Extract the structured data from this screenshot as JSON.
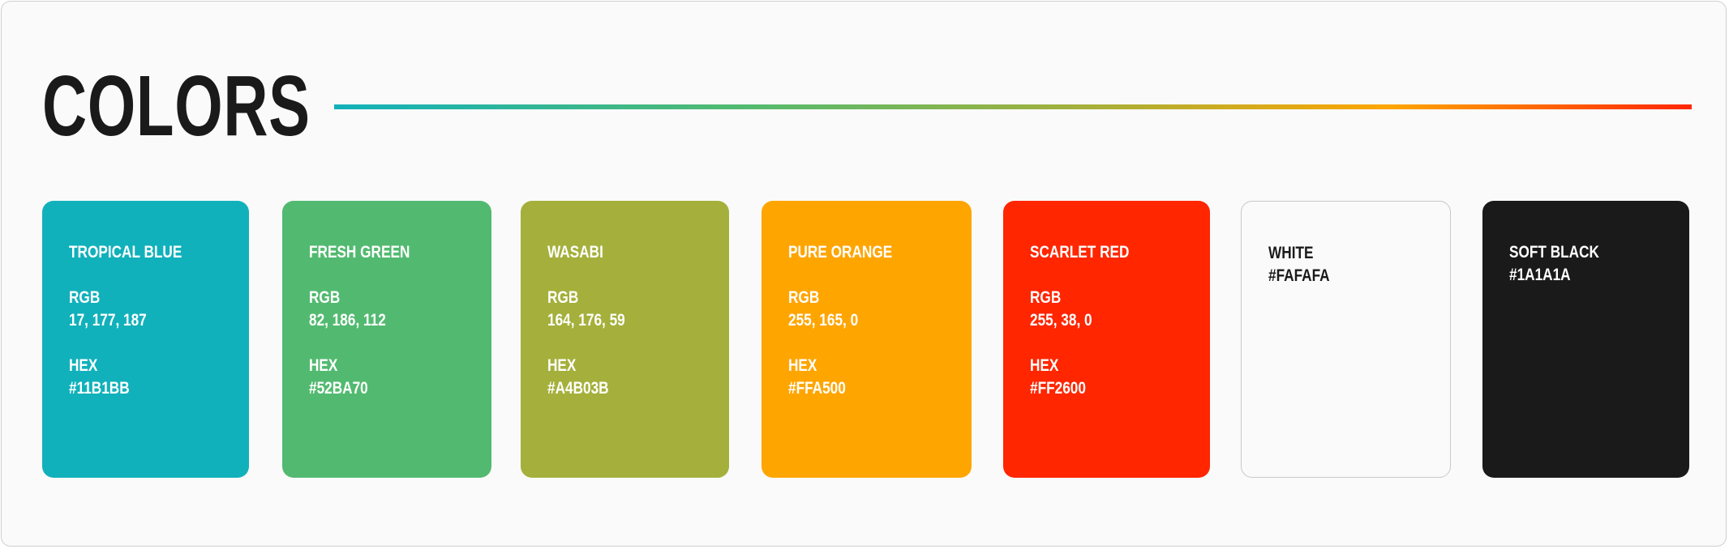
{
  "title": "COLORS",
  "swatches": [
    {
      "name": "TROPICAL BLUE",
      "rgb_label": "RGB",
      "rgb": "17, 177, 187",
      "hex_label": "HEX",
      "hex": "#11B1BB",
      "bg": "#11B1BB",
      "text_color": "#FFFFFF"
    },
    {
      "name": "FRESH GREEN",
      "rgb_label": "RGB",
      "rgb": "82, 186, 112",
      "hex_label": "HEX",
      "hex": "#52BA70",
      "bg": "#52BA70",
      "text_color": "#FFFFFF"
    },
    {
      "name": "WASABI",
      "rgb_label": "RGB",
      "rgb": "164, 176, 59",
      "hex_label": "HEX",
      "hex": "#A4B03B",
      "bg": "#A4B03B",
      "text_color": "#FFFFFF"
    },
    {
      "name": "PURE ORANGE",
      "rgb_label": "RGB",
      "rgb": "255, 165, 0",
      "hex_label": "HEX",
      "hex": "#FFA500",
      "bg": "#FFA500",
      "text_color": "#FFFFFF"
    },
    {
      "name": "SCARLET RED",
      "rgb_label": "RGB",
      "rgb": "255, 38, 0",
      "hex_label": "HEX",
      "hex": "#FF2600",
      "bg": "#FF2600",
      "text_color": "#FFFFFF"
    },
    {
      "name": "WHITE",
      "hex": "#FAFAFA",
      "bg": "#FAFAFA",
      "text_color": "#1A1A1A"
    },
    {
      "name": "SOFT BLACK",
      "hex": "#1A1A1A",
      "bg": "#1A1A1A",
      "text_color": "#FFFFFF"
    }
  ],
  "colors": {
    "page_background": "#FAFAFA",
    "title": "#1A1A1A",
    "gradient": [
      "#11B1BB",
      "#52BA70",
      "#A4B03B",
      "#FFA500",
      "#FF2600"
    ]
  }
}
